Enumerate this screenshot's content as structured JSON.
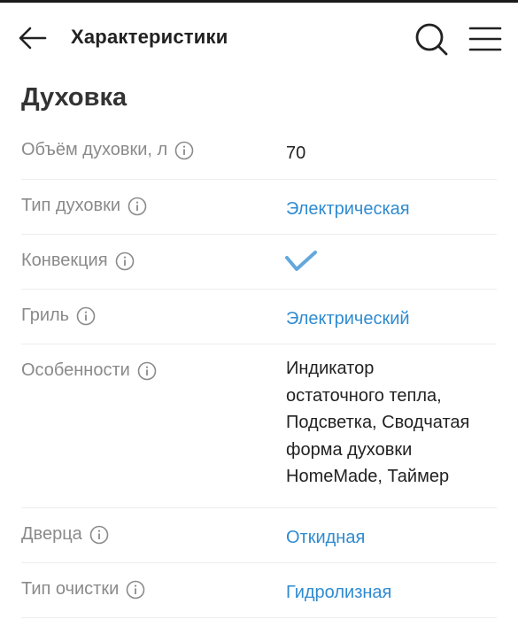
{
  "header": {
    "title": "Характеристики"
  },
  "section": {
    "title": "Духовка"
  },
  "specs": [
    {
      "label": "Объём духовки, л",
      "value": "70",
      "type": "text"
    },
    {
      "label": "Тип духовки",
      "value": "Электрическая",
      "type": "link"
    },
    {
      "label": "Конвекция",
      "value": "",
      "type": "check"
    },
    {
      "label": "Гриль",
      "value": "Электрический",
      "type": "link"
    },
    {
      "label": "Особенности",
      "value_lines": [
        "Индикатор",
        "остаточного тепла,",
        "Подсветка, Сводчатая",
        "форма духовки",
        "HomeMade, Таймер"
      ],
      "type": "text"
    },
    {
      "label": "Дверца",
      "value": "Откидная",
      "type": "link"
    },
    {
      "label": "Тип очистки",
      "value": "Гидролизная",
      "type": "link"
    }
  ],
  "icons": {
    "back": "arrow-left-icon",
    "search": "search-icon",
    "menu": "hamburger-menu-icon",
    "info": "info-icon",
    "check": "check-icon"
  },
  "colors": {
    "link": "#2f8bd0",
    "label": "#8a8a8a",
    "check": "#2f8bd0"
  }
}
